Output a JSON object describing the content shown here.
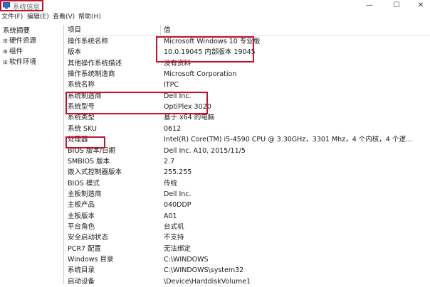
{
  "window": {
    "title": "系统信息",
    "controls": {
      "minimize": "—",
      "maximize": "☐",
      "close": "✕"
    }
  },
  "menu": [
    "文件(F)",
    "编辑(E)",
    "查看(V)",
    "帮助(H)"
  ],
  "sidebar": {
    "root": "系统摘要",
    "children": [
      "硬件资源",
      "组件",
      "软件环境"
    ]
  },
  "table": {
    "headers": [
      "项目",
      "值"
    ],
    "rows": [
      [
        "操作系统名称",
        "Microsoft Windows 10 专业版"
      ],
      [
        "版本",
        "10.0.19045 内部版本 19045"
      ],
      [
        "其他操作系统描述",
        "没有资料"
      ],
      [
        "操作系统制造商",
        "Microsoft Corporation"
      ],
      [
        "系统名称",
        "ITPC"
      ],
      [
        "系统制造商",
        "Dell Inc."
      ],
      [
        "系统型号",
        "OptiPlex 3020"
      ],
      [
        "系统类型",
        "基于 x64 的电脑"
      ],
      [
        "系统 SKU",
        "0612"
      ],
      [
        "处理器",
        "Intel(R) Core(TM) i5-4590 CPU @ 3.30GHz，3301 Mhz，4 个内核，4 个逻..."
      ],
      [
        "BIOS 版本/日期",
        "Dell Inc. A10, 2015/11/5"
      ],
      [
        "SMBIOS 版本",
        "2.7"
      ],
      [
        "嵌入式控制器版本",
        "255.255"
      ],
      [
        "BIOS 模式",
        "传统"
      ],
      [
        "主板制造商",
        "Dell Inc."
      ],
      [
        "主板产品",
        "040DDP"
      ],
      [
        "主板版本",
        "A01"
      ],
      [
        "平台角色",
        "台式机"
      ],
      [
        "安全启动状态",
        "不支持"
      ],
      [
        "PCR7 配置",
        "无法绑定"
      ],
      [
        "Windows 目录",
        "C:\\WINDOWS"
      ],
      [
        "系统目录",
        "C:\\WINDOWS\\system32"
      ],
      [
        "启动设备",
        "\\Device\\HarddiskVolume1"
      ]
    ]
  },
  "colors": {
    "highlight": "#c8102e"
  }
}
